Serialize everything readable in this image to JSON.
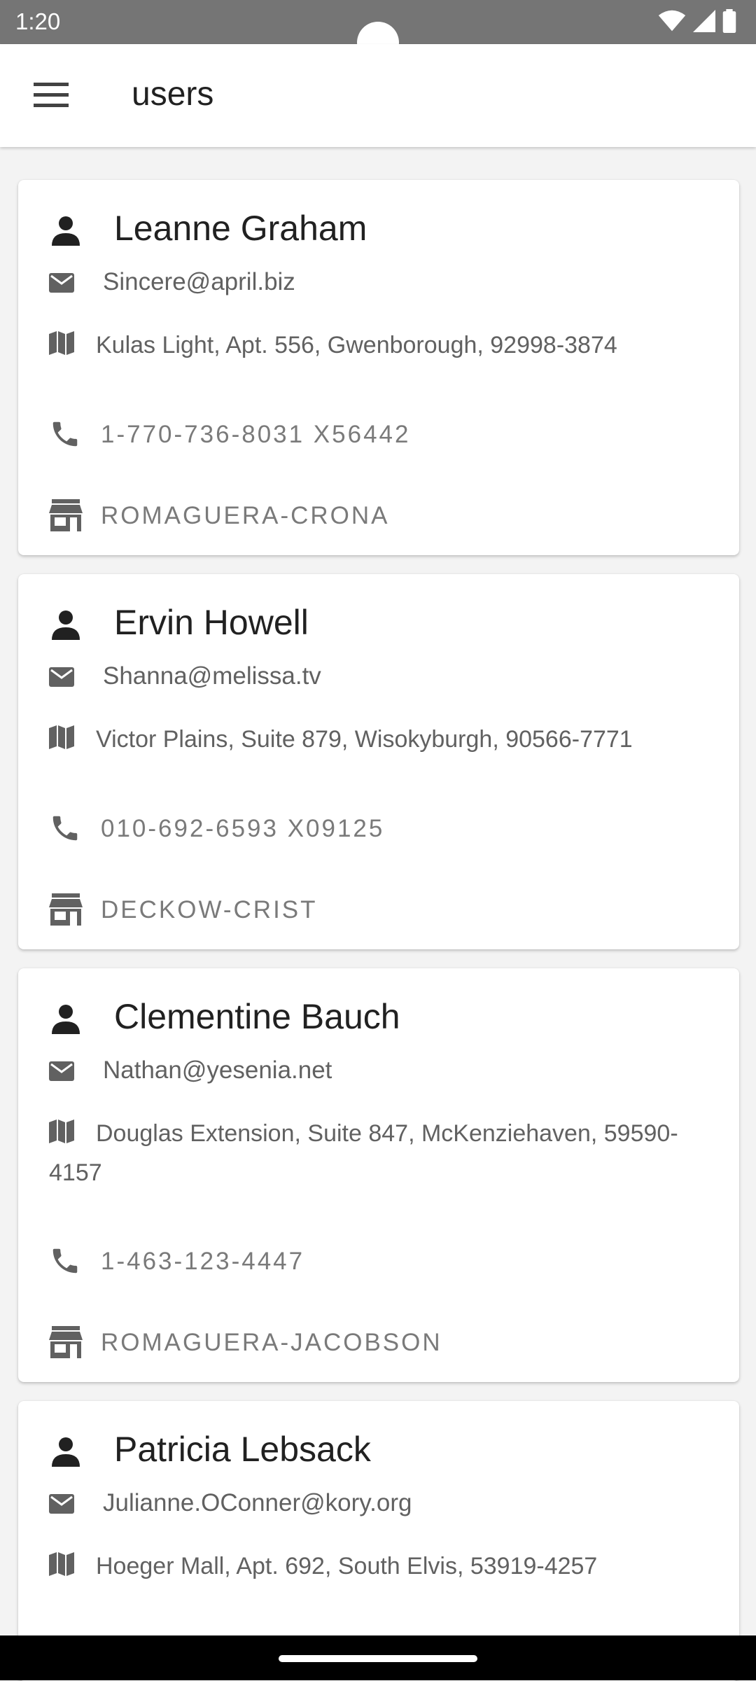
{
  "status_bar": {
    "time": "1:20"
  },
  "app_bar": {
    "title": "users"
  },
  "users": [
    {
      "name": "Leanne Graham",
      "email": "Sincere@april.biz",
      "address": "Kulas Light, Apt. 556, Gwenborough, 92998-3874",
      "phone": "1-770-736-8031 x56442",
      "company": "Romaguera-Crona"
    },
    {
      "name": "Ervin Howell",
      "email": "Shanna@melissa.tv",
      "address": "Victor Plains, Suite 879, Wisokyburgh, 90566-7771",
      "phone": "010-692-6593 x09125",
      "company": "Deckow-Crist"
    },
    {
      "name": "Clementine Bauch",
      "email": "Nathan@yesenia.net",
      "address": "Douglas Extension, Suite 847, McKenziehaven, 59590-4157",
      "phone": "1-463-123-4447",
      "company": "Romaguera-Jacobson"
    },
    {
      "name": "Patricia Lebsack",
      "email": "Julianne.OConner@kory.org",
      "address": "Hoeger Mall, Apt. 692, South Elvis, 53919-4257",
      "phone": "",
      "company": ""
    }
  ]
}
